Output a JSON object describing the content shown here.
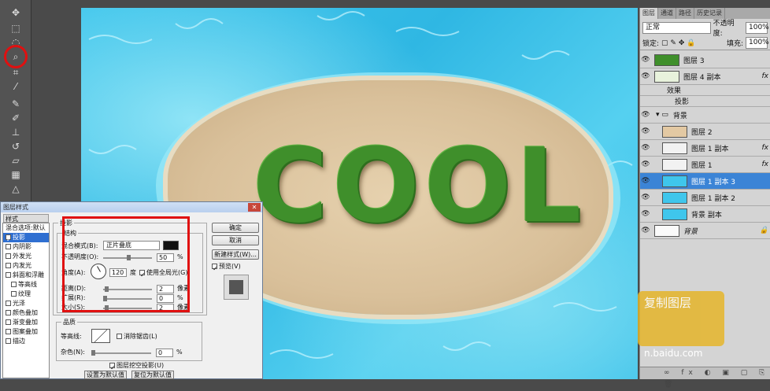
{
  "toolbar": {
    "tools": [
      "move-tool",
      "marquee-tool",
      "lasso-tool",
      "quick-select-tool",
      "crop-tool",
      "eyedropper-tool",
      "healing-brush-tool",
      "brush-tool",
      "clone-stamp-tool",
      "history-brush-tool",
      "eraser-tool",
      "gradient-tool",
      "pen-tool",
      "type-tool"
    ]
  },
  "canvas": {
    "text": "COOL"
  },
  "layers_panel": {
    "tabs": [
      "图层",
      "通道",
      "路径",
      "历史记录"
    ],
    "blend_mode": "正常",
    "opacity_label": "不透明度:",
    "opacity_value": "100%",
    "lock_label": "锁定:",
    "fill_label": "填充:",
    "fill_value": "100%",
    "layers": [
      {
        "name": "图层 3",
        "fx": ""
      },
      {
        "name": "图层 4 副本",
        "fx": "fx"
      },
      {
        "name": "效果",
        "fx": ""
      },
      {
        "name": "投影",
        "fx": ""
      },
      {
        "name": "背景",
        "fx": ""
      },
      {
        "name": "图层 2",
        "fx": ""
      },
      {
        "name": "图层 1 副本",
        "fx": "fx"
      },
      {
        "name": "图层 1",
        "fx": "fx"
      },
      {
        "name": "图层 1 副本 3",
        "fx": ""
      },
      {
        "name": "图层 1 副本 2",
        "fx": ""
      },
      {
        "name": "背景 副本",
        "fx": ""
      },
      {
        "name": "背景",
        "fx": ""
      }
    ],
    "footer_icons": "∞ fx ◐ ▣ ▢ ⎘ 🗑"
  },
  "watermark": {
    "line1": "复制图层",
    "url": "n.baidu.com"
  },
  "dialog": {
    "title": "图层样式",
    "styles_header": "样式",
    "styles": [
      "混合选项:默认",
      "投影",
      "内阴影",
      "外发光",
      "内发光",
      "斜面和浮雕",
      "等高线",
      "纹理",
      "光泽",
      "颜色叠加",
      "渐变叠加",
      "图案叠加",
      "描边"
    ],
    "section_title": "投影",
    "structure_title": "结构",
    "blend_label": "混合模式(B):",
    "blend_value": "正片叠底",
    "opacity_label": "不透明度(O):",
    "opacity_value": "50",
    "angle_label": "角度(A):",
    "angle_value": "120",
    "global_light": "使用全局光(G)",
    "distance_label": "距离(D):",
    "distance_value": "2",
    "spread_label": "扩展(R):",
    "spread_value": "0",
    "size_label": "大小(S):",
    "size_value": "2",
    "unit_px": "像素",
    "unit_pct": "%",
    "quality_title": "品质",
    "contour_label": "等高线:",
    "antialias": "消除锯齿(L)",
    "noise_label": "杂色(N):",
    "noise_value": "0",
    "layer_knocks": "图层挖空投影(U)",
    "set_default": "设置为默认值",
    "reset_default": "复位为默认值",
    "ok": "确定",
    "cancel": "取消",
    "new_style": "新建样式(W)...",
    "preview": "预览(V)"
  },
  "colors": {
    "highlight": "#e01010",
    "selected_layer": "#3b84d6",
    "grass": "#3f8f2b"
  }
}
